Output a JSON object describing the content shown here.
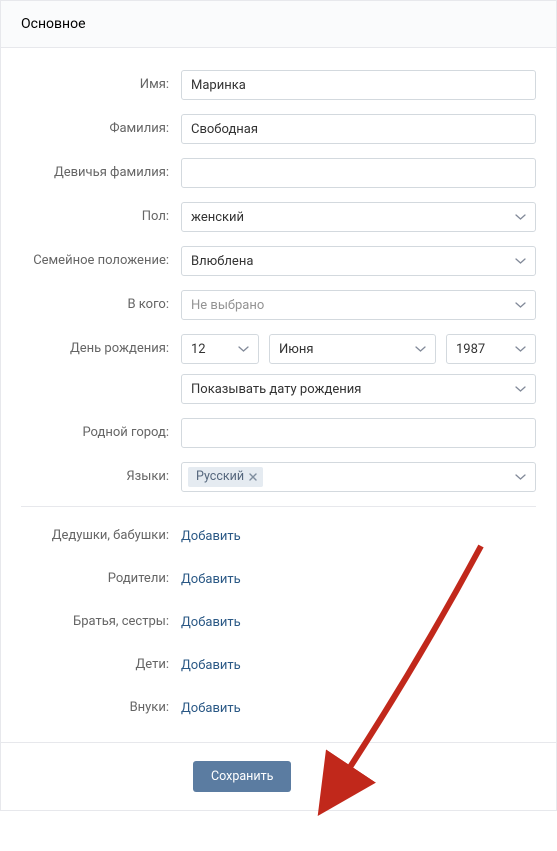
{
  "header": {
    "title": "Основное"
  },
  "form": {
    "name_label": "Имя:",
    "name_value": "Маринка",
    "surname_label": "Фамилия:",
    "surname_value": "Свободная",
    "maiden_label": "Девичья фамилия:",
    "maiden_value": "",
    "gender_label": "Пол:",
    "gender_value": "женский",
    "relationship_label": "Семейное положение:",
    "relationship_value": "Влюблена",
    "inwhom_label": "В кого:",
    "inwhom_value": "Не выбрано",
    "dob_label": "День рождения:",
    "dob_day": "12",
    "dob_month": "Июня",
    "dob_year": "1987",
    "dob_visibility": "Показывать дату рождения",
    "hometown_label": "Родной город:",
    "hometown_value": "",
    "languages_label": "Языки:",
    "languages_tag": "Русский"
  },
  "relatives": {
    "grandparents_label": "Дедушки, бабушки:",
    "parents_label": "Родители:",
    "siblings_label": "Братья, сестры:",
    "children_label": "Дети:",
    "grandchildren_label": "Внуки:",
    "add_link": "Добавить"
  },
  "footer": {
    "save_button": "Сохранить"
  }
}
